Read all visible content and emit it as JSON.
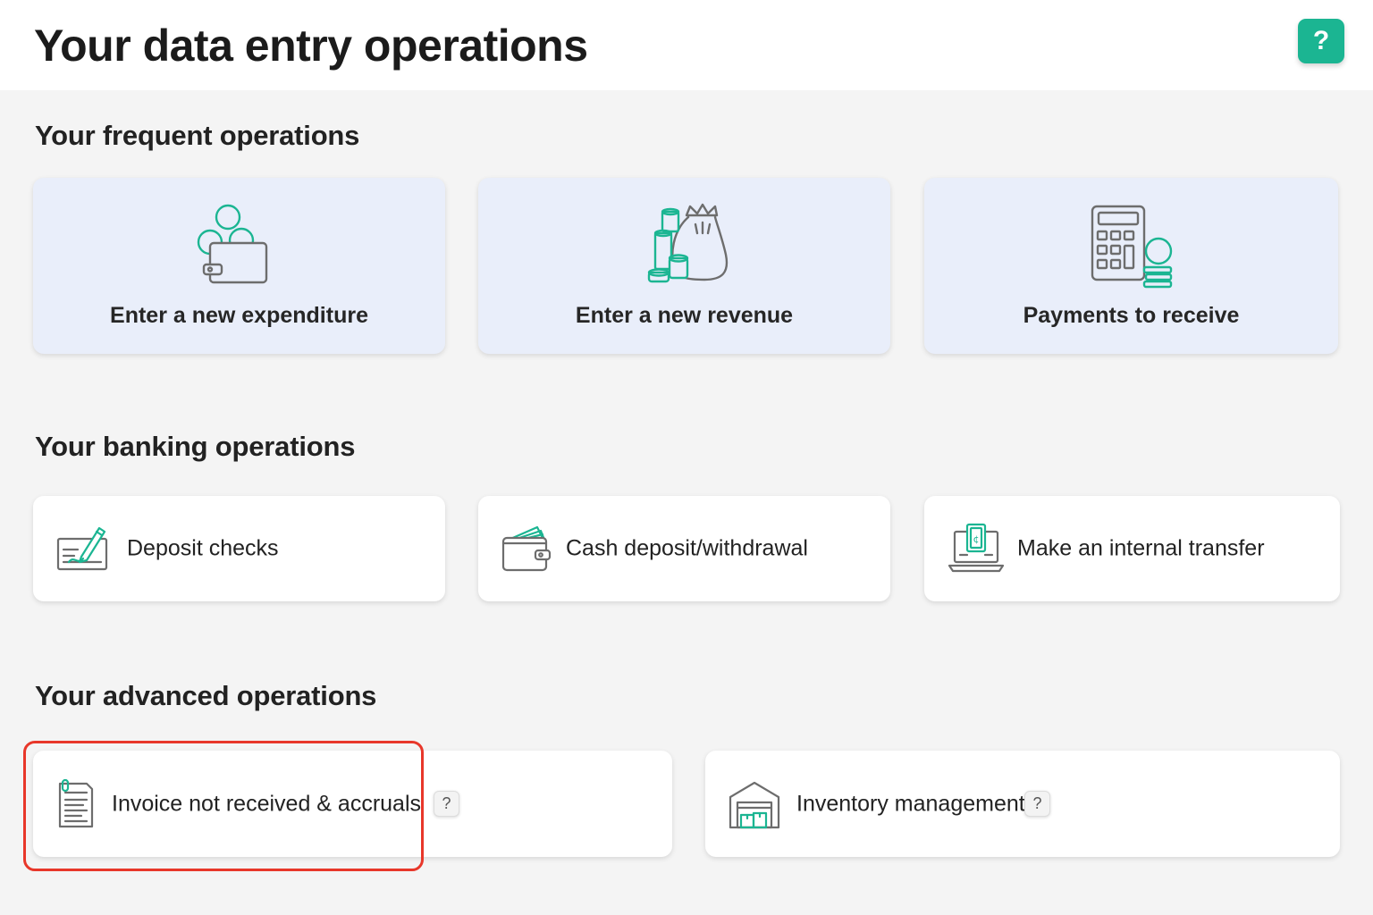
{
  "header": {
    "title": "Your data entry operations",
    "help_label": "?"
  },
  "sections": {
    "frequent": {
      "title": "Your frequent operations",
      "items": [
        {
          "label": "Enter a new expenditure",
          "icon": "wallet-coins-icon"
        },
        {
          "label": "Enter a new revenue",
          "icon": "money-bag-coins-icon"
        },
        {
          "label": "Payments to receive",
          "icon": "calculator-coins-icon"
        }
      ]
    },
    "banking": {
      "title": "Your banking operations",
      "items": [
        {
          "label": "Deposit checks",
          "icon": "check-pen-icon"
        },
        {
          "label": "Cash deposit/withdrawal",
          "icon": "wallet-cash-icon"
        },
        {
          "label": "Make an internal transfer",
          "icon": "laptop-transfer-icon"
        }
      ]
    },
    "advanced": {
      "title": "Your advanced operations",
      "items": [
        {
          "label": "Invoice not received & accruals",
          "icon": "invoice-document-icon",
          "help": "?"
        },
        {
          "label": "Inventory management",
          "icon": "warehouse-icon",
          "help": "?"
        }
      ]
    }
  },
  "colors": {
    "accent": "#1bb592",
    "icon_stroke": "#6d6d6d",
    "highlight": "#e8372a",
    "frequent_card_bg": "#e9eefa"
  }
}
